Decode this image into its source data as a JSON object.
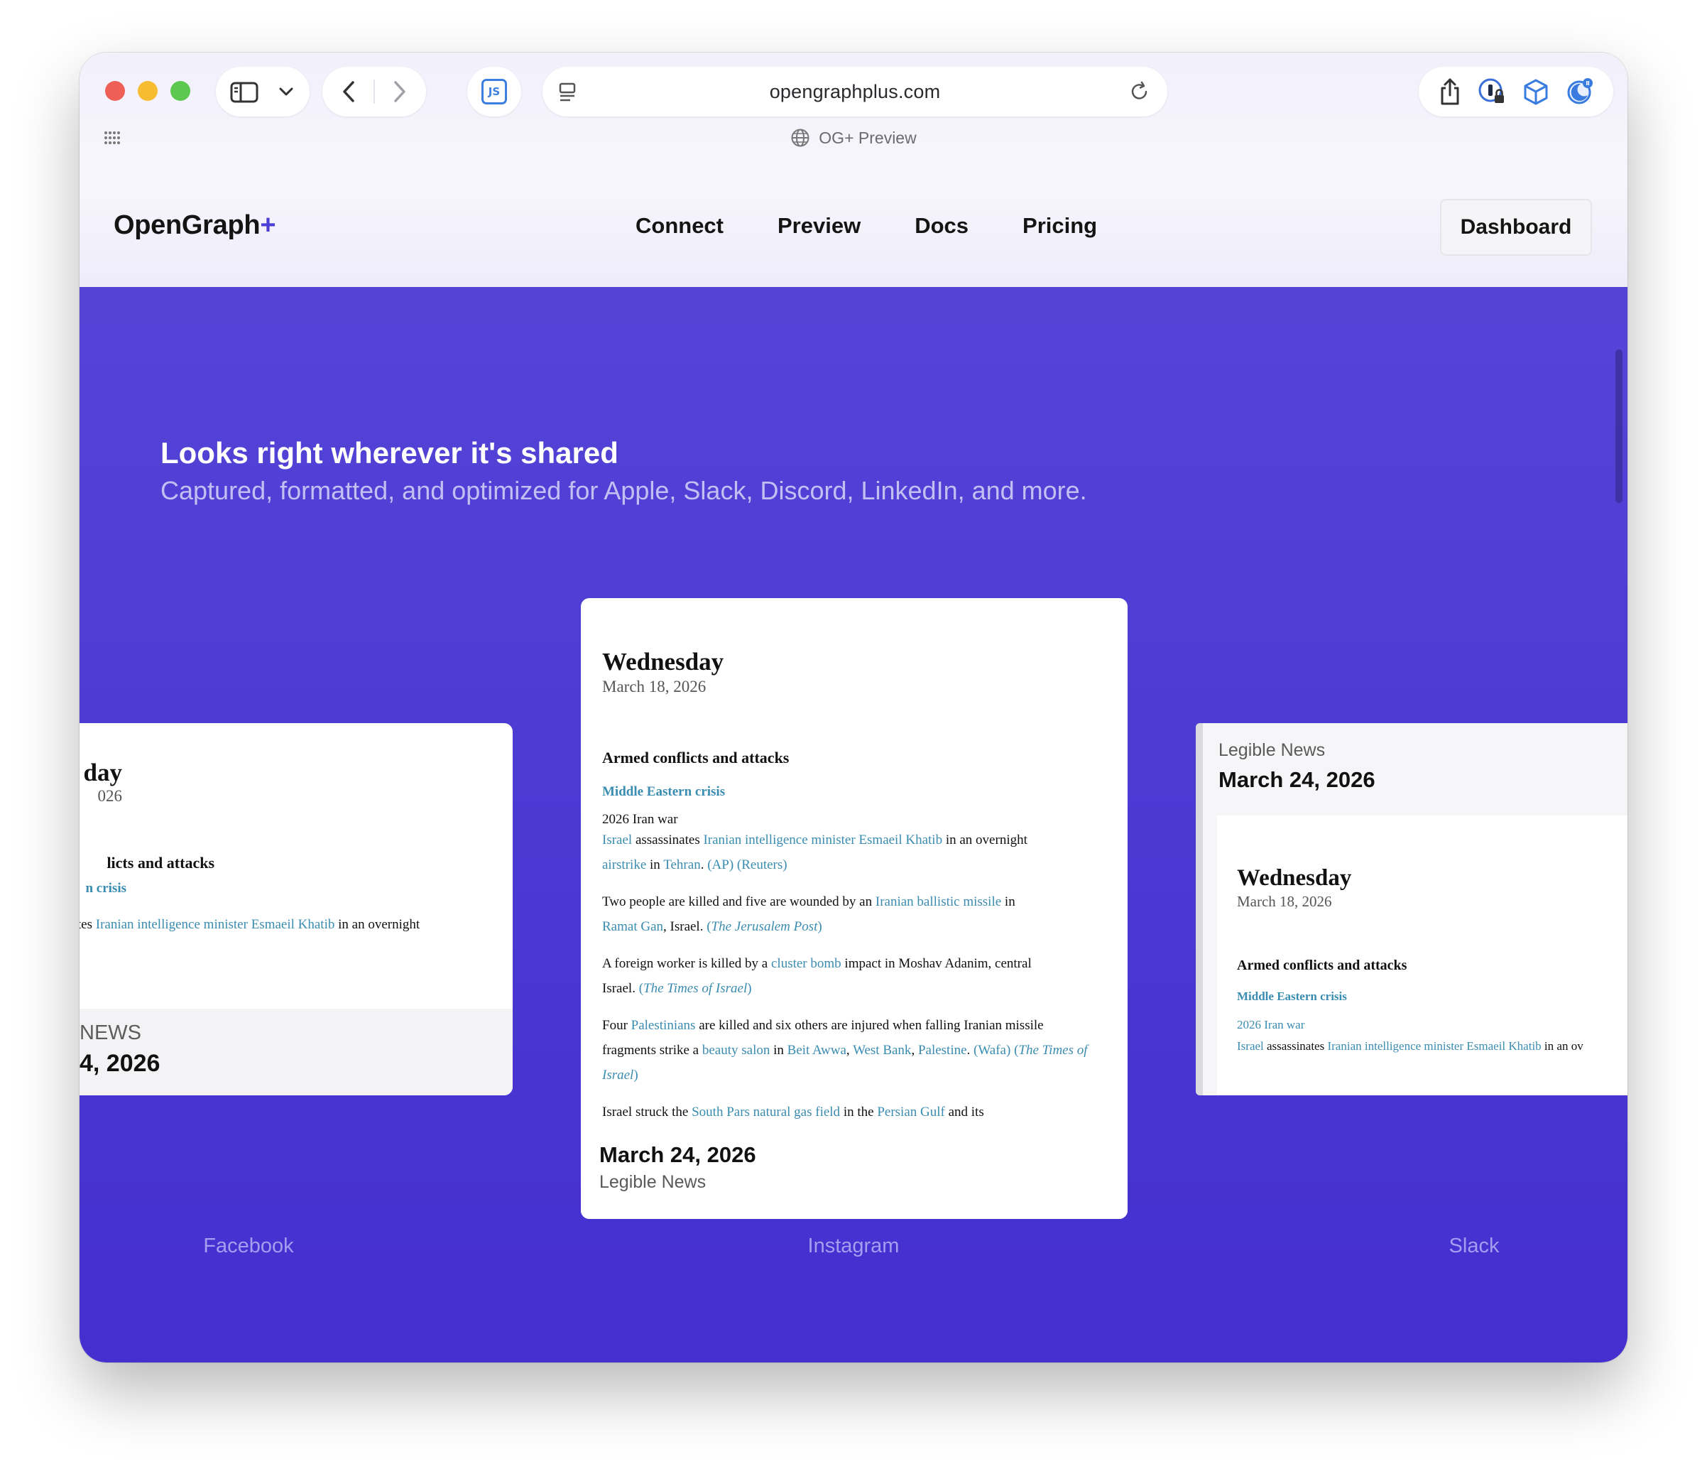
{
  "browser": {
    "url": "opengraphplus.com",
    "tab_title": "OG+ Preview",
    "js_badge": "JS"
  },
  "site": {
    "logo_text": "OpenGraph",
    "logo_plus": "+",
    "nav": [
      "Connect",
      "Preview",
      "Docs",
      "Pricing"
    ],
    "dashboard_label": "Dashboard"
  },
  "hero": {
    "title": "Looks right wherever it's shared",
    "subtitle": "Captured, formatted, and optimized for Apple, Slack, Discord, LinkedIn, and more."
  },
  "article": {
    "day": "Wednesday",
    "date": "March 18, 2026",
    "section": "Armed conflicts and attacks",
    "crisis": "Middle Eastern crisis",
    "war": "2026 Iran war",
    "p1": {
      "israel": "Israel",
      "assassinates": "assassinates",
      "minister": "Iranian intelligence minister Esmaeil Khatib",
      "in_overnight": "in an overnight",
      "airstrike": "airstrike",
      "in": "in",
      "tehran": "Tehran",
      "sources": "(AP) (Reuters)"
    },
    "p2": {
      "text1": "Two people are killed and five are wounded by an",
      "missile": "Iranian ballistic missile",
      "in": "in",
      "ramat": "Ramat Gan",
      "text2": ", Israel.",
      "source": "The Jerusalem Post"
    },
    "p3": {
      "text1": "A foreign worker is killed by a",
      "bomb": "cluster bomb",
      "text2": "impact in Moshav Adanim, central",
      "text3": "Israel.",
      "source": "The Times of Israel"
    },
    "p4": {
      "four": "Four",
      "palestinians": "Palestinians",
      "text1": "are killed and six others are injured when falling Iranian missile",
      "text2": "fragments strike a",
      "salon": "beauty salon",
      "in": "in",
      "awwa": "Beit Awwa",
      "westbank": "West Bank",
      "palestine": "Palestine",
      "wafa": "(Wafa)",
      "source": "The Times of Israel"
    },
    "p5": {
      "text1": "Israel struck the",
      "pars": "South Pars natural gas field",
      "text2": "in the",
      "gulf": "Persian Gulf",
      "text3": "and its"
    },
    "footer_date": "March 24, 2026",
    "source": "Legible News"
  },
  "left_card": {
    "day": "day",
    "date": "026",
    "section": "licts and attacks",
    "crisis": "n crisis",
    "line_start": "tes",
    "minister": "Iranian intelligence minister Esmaeil Khatib",
    "line_end": "in an overnight",
    "news": "NEWS",
    "footer_date": "4, 2026"
  },
  "right_card": {
    "source": "Legible News",
    "date": "March 24, 2026",
    "line_end": "in an ov"
  },
  "platforms": [
    "Facebook",
    "Instagram",
    "Slack"
  ]
}
